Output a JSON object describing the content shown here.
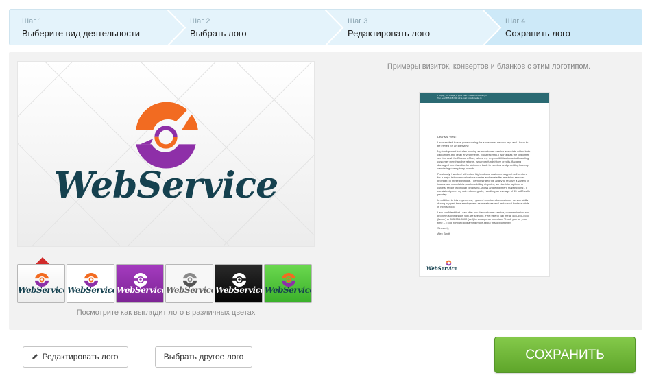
{
  "steps": [
    {
      "num": "Шаг 1",
      "title": "Выберите вид деятельности"
    },
    {
      "num": "Шаг 2",
      "title": "Выбрать лого"
    },
    {
      "num": "Шаг 3",
      "title": "Редактировать лого"
    },
    {
      "num": "Шаг 4",
      "title": "Сохранить лого",
      "active": true
    }
  ],
  "logo": {
    "wordmark": "WebService",
    "colors": {
      "orange": "#f26b21",
      "purple": "#8e2fa8",
      "navy": "#15414f"
    }
  },
  "variants": [
    {
      "text": "WebService",
      "background": "#ffffff",
      "text_color": "#15414f",
      "icon": "orange-purple"
    },
    {
      "text": "WebService",
      "background": "#ffffff",
      "text_color": "#15414f",
      "icon": "orange-purple"
    },
    {
      "text": "WebService",
      "background": "#8e2fa8",
      "text_color": "#ffffff",
      "icon": "white"
    },
    {
      "text": "WebService",
      "background": "#ffffff",
      "text_color": "#666666",
      "icon": "gray"
    },
    {
      "text": "WebService",
      "background": "#111111",
      "text_color": "#ffffff",
      "icon": "white"
    },
    {
      "text": "WebService",
      "background": "#4fc23a",
      "text_color": "#15414f",
      "icon": "orange-purple"
    }
  ],
  "variants_caption": "Посмотрите как выглядит лого в различных цветах",
  "examples_title": "Примеры визиток, конвертов и бланков с этим логотипом.",
  "letter": {
    "header_lines": [
      "• Город, ул. Улица, д. Дом Сайт • www.mycompany.ru",
      "Тел. +22 555 678 900 23 E-mail: info@mysite.ru"
    ],
    "paragraphs": [
      "Dear Ms. West:",
      "I was excited to see your opening for a customer service rep, and I hope to be invited for an interview.",
      "My background includes serving as a customer service associate within both call-center and retail environments. Most recently, I worked as the customer service desk for Discount-Mart, where my responsibilities included handling customer merchandise returns, issuing refunds/store credits, flagging damaged merchandise for shipment back to vendors and providing back-up cashiering during busy periods.",
      "Previously, I worked within two high-volume customer-support call centers for a major telecommunications carrier and a satellite television services provider. In these positions, I demonstrated the ability to resolve a variety of issues and complaints (such as billing disputes, service interruptions or cutoffs, repair technician delays/no-shows and equipment malfunctions). I consistently met my call-volume goals, handling an average of 65 to 80 calls per day.",
      "In addition to this experience, I gained considerable customer service skills during my part-time employment as a waitress and restaurant hostess while in high school.",
      "I am confident that I can offer you the customer service, communication and problem-solving skills you are seeking. Feel free to call me at 555-555-5555 (home) or 555-555-5500 (cell) to arrange an interview. Thank you for your time -- I look forward to learning more about this opportunity!",
      "Sincerely,",
      "Alex Smith"
    ],
    "signature": "WebService"
  },
  "buttons": {
    "edit": "Редактировать лого",
    "other": "Выбрать другое лого",
    "save": "СОХРАНИТЬ"
  }
}
